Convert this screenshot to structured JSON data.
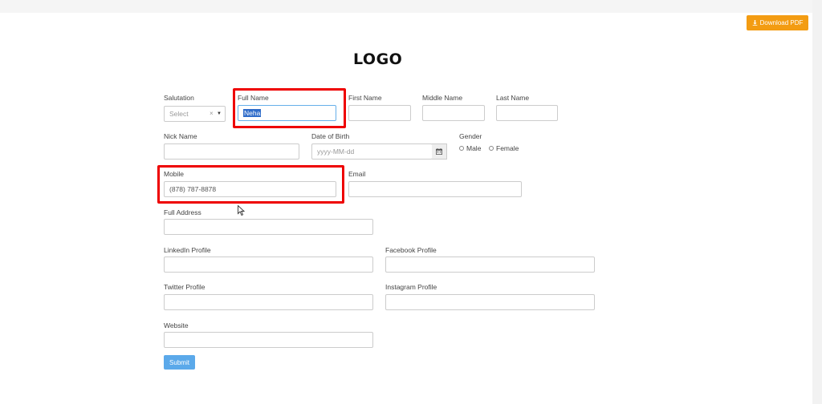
{
  "header": {
    "download_label": "Download PDF",
    "logo_text": "LOGO"
  },
  "form": {
    "salutation": {
      "label": "Salutation",
      "placeholder": "Select"
    },
    "full_name": {
      "label": "Full Name",
      "value": "Neha"
    },
    "first_name": {
      "label": "First Name",
      "value": ""
    },
    "middle_name": {
      "label": "Middle Name",
      "value": ""
    },
    "last_name": {
      "label": "Last Name",
      "value": ""
    },
    "nick_name": {
      "label": "Nick Name",
      "value": ""
    },
    "dob": {
      "label": "Date of Birth",
      "placeholder": "yyyy-MM-dd"
    },
    "gender": {
      "label": "Gender",
      "options": [
        "Male",
        "Female"
      ]
    },
    "mobile": {
      "label": "Mobile",
      "value": "(878) 787-8878"
    },
    "email": {
      "label": "Email",
      "value": ""
    },
    "full_address": {
      "label": "Full Address",
      "value": ""
    },
    "linkedin": {
      "label": "LinkedIn Profile",
      "value": ""
    },
    "facebook": {
      "label": "Facebook Profile",
      "value": ""
    },
    "twitter": {
      "label": "Twitter Profile",
      "value": ""
    },
    "instagram": {
      "label": "Instagram Profile",
      "value": ""
    },
    "website": {
      "label": "Website",
      "value": ""
    },
    "submit_label": "Submit"
  },
  "colors": {
    "download_button": "#f39c12",
    "submit_button": "#5ba9ea",
    "highlight_box": "#ee0000",
    "selection": "#2f6cc9"
  }
}
